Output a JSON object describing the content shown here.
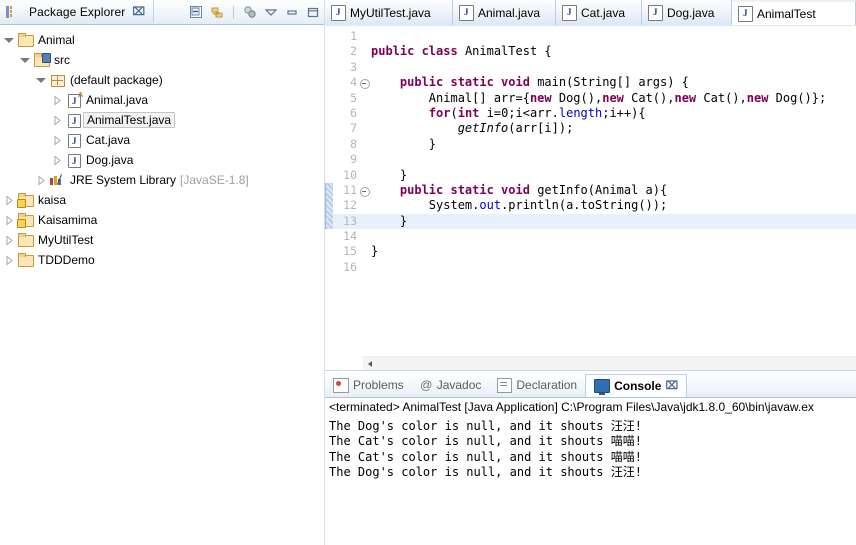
{
  "explorer": {
    "tab_title": "Package Explorer",
    "close_glyph": "⌧",
    "toolbar": [
      {
        "name": "collapse-all-icon"
      },
      {
        "name": "link-with-editor-icon"
      },
      {
        "name": "view-menu-icon"
      },
      {
        "name": "chevron-down-icon"
      },
      {
        "name": "minimize-icon"
      },
      {
        "name": "maximize-icon"
      }
    ],
    "tree": [
      {
        "label": "Animal",
        "indent": 0,
        "expander": "open",
        "icon": "project-folder-icon",
        "selected": false,
        "suffix": ""
      },
      {
        "label": "src",
        "indent": 1,
        "expander": "open",
        "icon": "source-folder-icon",
        "selected": false,
        "suffix": ""
      },
      {
        "label": "(default package)",
        "indent": 2,
        "expander": "open",
        "icon": "package-icon",
        "selected": false,
        "suffix": ""
      },
      {
        "label": "Animal.java",
        "indent": 3,
        "expander": "closed",
        "icon": "java-abstract-file-icon",
        "selected": false,
        "suffix": ""
      },
      {
        "label": "AnimalTest.java",
        "indent": 3,
        "expander": "closed",
        "icon": "java-file-icon",
        "selected": true,
        "suffix": ""
      },
      {
        "label": "Cat.java",
        "indent": 3,
        "expander": "closed",
        "icon": "java-file-icon",
        "selected": false,
        "suffix": ""
      },
      {
        "label": "Dog.java",
        "indent": 3,
        "expander": "closed",
        "icon": "java-file-icon",
        "selected": false,
        "suffix": ""
      },
      {
        "label": "JRE System Library",
        "indent": 2,
        "expander": "closed",
        "icon": "jre-library-icon",
        "selected": false,
        "suffix": "[JavaSE-1.8]"
      },
      {
        "label": "kaisa",
        "indent": 0,
        "expander": "closed",
        "icon": "project-folder-warning-icon",
        "selected": false,
        "suffix": ""
      },
      {
        "label": "Kaisamima",
        "indent": 0,
        "expander": "closed",
        "icon": "project-folder-warning-icon",
        "selected": false,
        "suffix": ""
      },
      {
        "label": "MyUtilTest",
        "indent": 0,
        "expander": "closed",
        "icon": "project-folder-icon",
        "selected": false,
        "suffix": ""
      },
      {
        "label": "TDDDemo",
        "indent": 0,
        "expander": "closed",
        "icon": "project-folder-icon",
        "selected": false,
        "suffix": ""
      }
    ]
  },
  "editor": {
    "tabs": [
      {
        "label": "MyUtilTest.java",
        "active": false
      },
      {
        "label": "Animal.java",
        "active": false
      },
      {
        "label": "Cat.java",
        "active": false
      },
      {
        "label": "Dog.java",
        "active": false
      },
      {
        "label": "AnimalTest",
        "active": true
      }
    ],
    "current_line": 13,
    "change_marker_lines": [
      11,
      12,
      13
    ],
    "fold_lines": [
      4,
      11
    ],
    "total_lines": 16,
    "lines": [
      {
        "n": 1,
        "segments": []
      },
      {
        "n": 2,
        "segments": [
          {
            "t": "public ",
            "c": "kw"
          },
          {
            "t": "class ",
            "c": "kw"
          },
          {
            "t": "AnimalTest {",
            "c": "nm"
          }
        ]
      },
      {
        "n": 3,
        "segments": []
      },
      {
        "n": 4,
        "segments": [
          {
            "t": "    ",
            "c": "nm"
          },
          {
            "t": "public static void ",
            "c": "kw"
          },
          {
            "t": "main(String[] args) {",
            "c": "nm"
          }
        ]
      },
      {
        "n": 5,
        "segments": [
          {
            "t": "        Animal[] arr={",
            "c": "nm"
          },
          {
            "t": "new ",
            "c": "kw"
          },
          {
            "t": "Dog(),",
            "c": "nm"
          },
          {
            "t": "new ",
            "c": "kw"
          },
          {
            "t": "Cat(),",
            "c": "nm"
          },
          {
            "t": "new ",
            "c": "kw"
          },
          {
            "t": "Cat(),",
            "c": "nm"
          },
          {
            "t": "new ",
            "c": "kw"
          },
          {
            "t": "Dog()};",
            "c": "nm"
          }
        ]
      },
      {
        "n": 6,
        "segments": [
          {
            "t": "        ",
            "c": "nm"
          },
          {
            "t": "for",
            "c": "kw"
          },
          {
            "t": "(",
            "c": "nm"
          },
          {
            "t": "int ",
            "c": "kw"
          },
          {
            "t": "i=0;i<arr.",
            "c": "nm"
          },
          {
            "t": "length",
            "c": "fld"
          },
          {
            "t": ";i++){",
            "c": "nm"
          }
        ]
      },
      {
        "n": 7,
        "segments": [
          {
            "t": "            ",
            "c": "nm"
          },
          {
            "t": "getInfo",
            "c": "mth"
          },
          {
            "t": "(arr[i]);",
            "c": "nm"
          }
        ]
      },
      {
        "n": 8,
        "segments": [
          {
            "t": "        }",
            "c": "nm"
          }
        ]
      },
      {
        "n": 9,
        "segments": []
      },
      {
        "n": 10,
        "segments": [
          {
            "t": "    }",
            "c": "nm"
          }
        ]
      },
      {
        "n": 11,
        "segments": [
          {
            "t": "    ",
            "c": "nm"
          },
          {
            "t": "public static void ",
            "c": "kw"
          },
          {
            "t": "getInfo(Animal a){",
            "c": "nm"
          }
        ]
      },
      {
        "n": 12,
        "segments": [
          {
            "t": "        System.",
            "c": "nm"
          },
          {
            "t": "out",
            "c": "fld"
          },
          {
            "t": ".println(a.toString());",
            "c": "nm"
          }
        ]
      },
      {
        "n": 13,
        "segments": [
          {
            "t": "    }",
            "c": "nm"
          }
        ]
      },
      {
        "n": 14,
        "segments": []
      },
      {
        "n": 15,
        "segments": [
          {
            "t": "}",
            "c": "nm"
          }
        ]
      },
      {
        "n": 16,
        "segments": []
      }
    ]
  },
  "console": {
    "tabs": [
      {
        "label": "Problems",
        "icon": "problems-icon",
        "active": false
      },
      {
        "label": "Javadoc",
        "icon": "javadoc-icon",
        "active": false
      },
      {
        "label": "Declaration",
        "icon": "declaration-icon",
        "active": false
      },
      {
        "label": "Console",
        "icon": "console-icon",
        "active": true
      }
    ],
    "close_glyph": "⌧",
    "launch_header": "<terminated> AnimalTest [Java Application] C:\\Program Files\\Java\\jdk1.8.0_60\\bin\\javaw.ex",
    "output": [
      "The Dog's color is null, and it shouts 汪汪!",
      "The Cat's color is null, and it shouts 喵喵!",
      "The Cat's color is null, and it shouts 喵喵!",
      "The Dog's color is null, and it shouts 汪汪!"
    ]
  }
}
